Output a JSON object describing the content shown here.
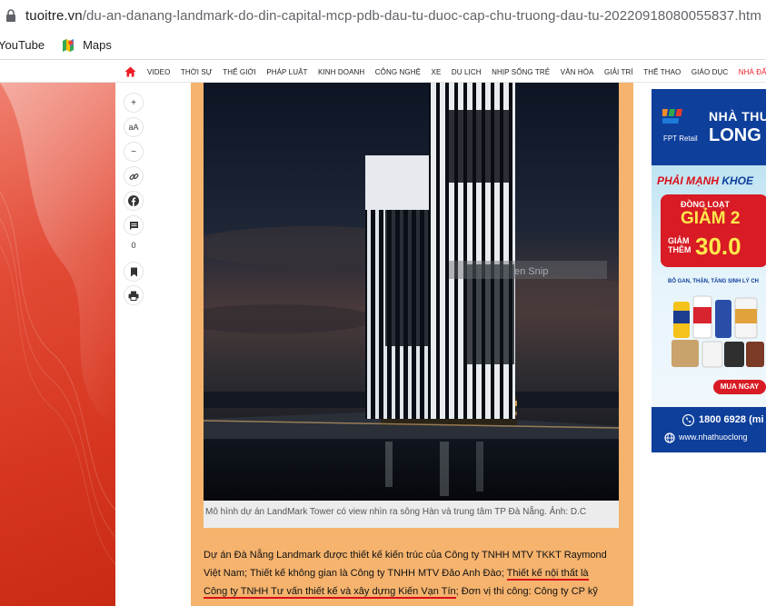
{
  "browser": {
    "url_host": "tuoitre.vn",
    "url_path": "/du-an-danang-landmark-do-din-capital-mcp-pdb-dau-tu-duoc-cap-chu-truong-dau-tu-20220918080055837.htm",
    "bookmarks": [
      {
        "label": "YouTube",
        "icon": "youtube-icon"
      },
      {
        "label": "Maps",
        "icon": "maps-icon"
      }
    ]
  },
  "site_nav": {
    "items": [
      "VIDEO",
      "THỜI SỰ",
      "THẾ GIỚI",
      "PHÁP LUẬT",
      "KINH DOANH",
      "CÔNG NGHỆ",
      "XE",
      "DU LỊCH",
      "NHỊP SỐNG TRẺ",
      "VĂN HÓA",
      "GIẢI TRÍ",
      "THỂ THAO",
      "GIÁO DỤC"
    ],
    "highlight_item": "NHÀ ĐẤT",
    "accent_color": "#ed1c24"
  },
  "toolbar": {
    "zoom_in": "+",
    "font_size": "aA",
    "zoom_out": "−",
    "comment_count": "0"
  },
  "article": {
    "caption": "Mô hình dự án LandMark Tower có view nhìn ra sông Hàn và trung tâm TP Đà Nẵng. Ảnh: D.C",
    "para_part1": "Dự án Đà Nẵng Landmark được thiết kế kiến trúc của Công ty TNHH MTV TKKT Raymond Việt Nam; Thiết kế không gian là Công ty TNHH MTV Đảo Anh Đào; ",
    "para_underlined": "Thiết kế nội thất là Công ty TNHH Tư vấn thiết kế và xây dựng Kiến Vạn Tín",
    "para_part2": "; Đơn vị thi công: Công ty CP kỹ",
    "photo_overlay_text": "en Snip",
    "background_color": "#f5b36e"
  },
  "ad": {
    "brand_line1": "NHÀ THU",
    "brand_line2": "LONG",
    "retail_label": "FPT Retail",
    "slogan_a": "PHẢI MẠNH",
    "slogan_b": " KHOE",
    "promo_line1": "ĐỒNG LOẠT",
    "promo_line2": "GIẢM 2",
    "promo_line3a": "GIẢM",
    "promo_line3b": "THÊM",
    "promo_amount": "30.0",
    "small_text": "BỔ GAN, THẬN, TĂNG SINH LÝ CH",
    "buy_label": "MUA NGAY",
    "phone": "1800 6928",
    "phone_suffix": "(mi",
    "website": "www.nhathuoclong"
  }
}
